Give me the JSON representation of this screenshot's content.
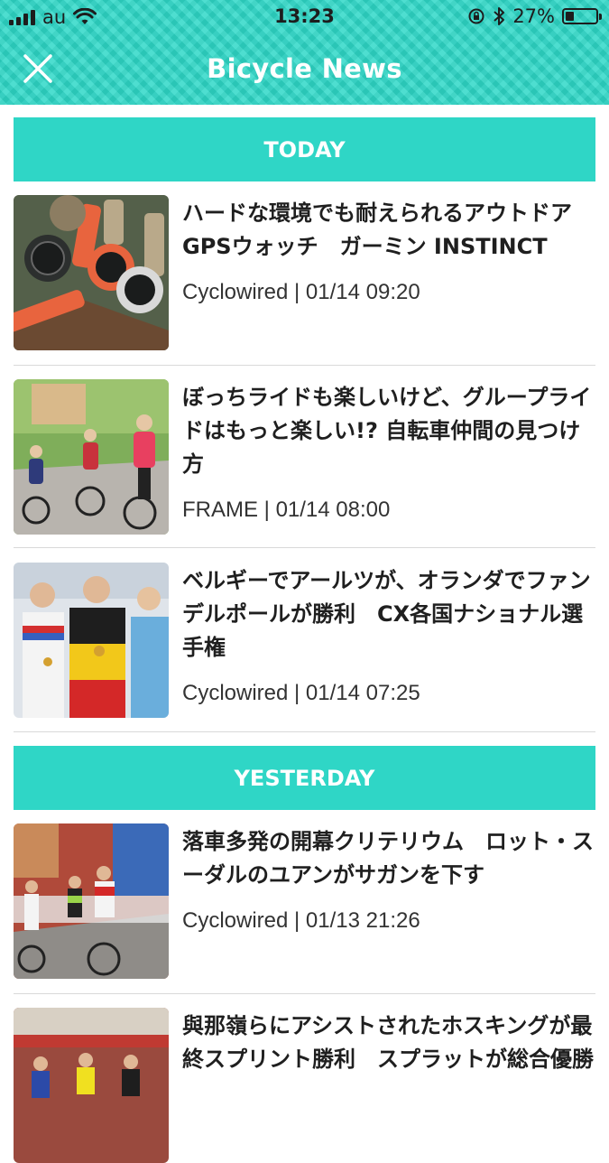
{
  "status_bar": {
    "carrier": "au",
    "time": "13:23",
    "battery_percent": "27%",
    "battery_level": 0.27
  },
  "nav": {
    "title": "Bicycle News",
    "close_icon": "close-icon"
  },
  "sections": [
    {
      "label": "TODAY",
      "items": [
        {
          "title": "ハードな環境でも耐えられるアウトドアGPSウォッチ　ガーミン INSTINCT",
          "meta": "Cyclowired | 01/14 09:20"
        },
        {
          "title": "ぼっちライドも楽しいけど、グループライドはもっと楽しい!? 自転車仲間の見つけ方",
          "meta": "FRAME | 01/14 08:00"
        },
        {
          "title": "ベルギーでアールツが、オランダでファンデルポールが勝利　CX各国ナショナル選手権",
          "meta": "Cyclowired | 01/14 07:25"
        }
      ]
    },
    {
      "label": "YESTERDAY",
      "items": [
        {
          "title": "落車多発の開幕クリテリウム　ロット・スーダルのユアンがサガンを下す",
          "meta": "Cyclowired | 01/13 21:26"
        },
        {
          "title": "與那嶺らにアシストされたホスキングが最終スプリント勝利　スプラットが総合優勝",
          "meta": ""
        }
      ]
    }
  ],
  "colors": {
    "accent": "#2fd6c6",
    "header_bg": "#2ed8c8",
    "title_text": "#ffffff"
  }
}
